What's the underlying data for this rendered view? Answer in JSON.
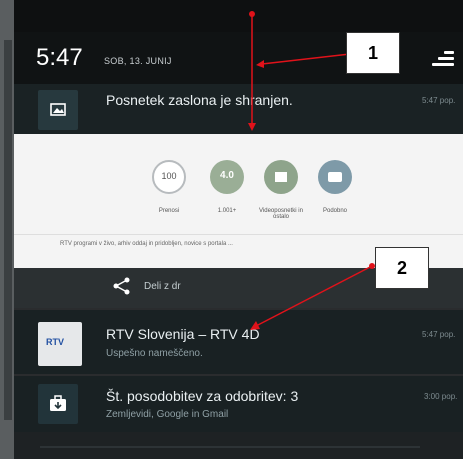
{
  "status_bar": {
    "time": "5:47",
    "date": "SOB, 13. JUNIJ"
  },
  "notifications": [
    {
      "id": "screenshot",
      "title": "Posnetek zaslona je shranjen.",
      "timestamp": "5:47 pop."
    },
    {
      "id": "rtv",
      "title": "RTV Slovenija – RTV 4D",
      "subtitle": "Uspešno nameščeno.",
      "timestamp": "5:47 pop.",
      "icon_text": "RTV"
    },
    {
      "id": "updates",
      "title": "Št. posodobitev za odobritev: 3",
      "subtitle": "Zemljevidi, Google in Gmail",
      "timestamp": "3:00 pop."
    }
  ],
  "expanded_preview": {
    "items": [
      {
        "badge": "100",
        "label": "Prenosi"
      },
      {
        "badge": "4.0",
        "label": "1.001+"
      },
      {
        "label": "Videoposnetki in ostalo"
      },
      {
        "label": "Podobno"
      }
    ],
    "caption": "RTV programi v živo, arhiv oddaj in pridobljen, novice s portala ..."
  },
  "share": {
    "label": "Deli z dr"
  },
  "callouts": [
    {
      "label": "1"
    },
    {
      "label": "2"
    }
  ],
  "colors": {
    "callout_arrow": "#e0121a",
    "panel_bg": "#192123",
    "preview_bg": "#f4f4f4"
  }
}
